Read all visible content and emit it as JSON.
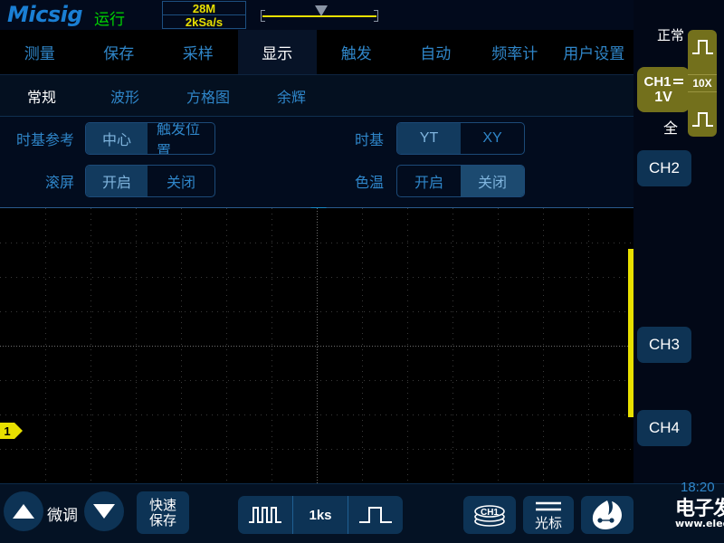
{
  "header": {
    "brand": "Micsig",
    "run_state": "运行",
    "memory_depth": "28M",
    "sample_rate": "2kSa/s",
    "trigger_marker_icon": "trigger-position-marker"
  },
  "menu": {
    "tabs": [
      {
        "label": "测量",
        "active": false
      },
      {
        "label": "保存",
        "active": false
      },
      {
        "label": "采样",
        "active": false
      },
      {
        "label": "显示",
        "active": true
      },
      {
        "label": "触发",
        "active": false
      },
      {
        "label": "自动",
        "active": false
      },
      {
        "label": "频率计",
        "active": false
      },
      {
        "label": "用户设置",
        "active": false
      }
    ]
  },
  "subtabs": [
    {
      "label": "常规",
      "active": true
    },
    {
      "label": "波形",
      "active": false
    },
    {
      "label": "方格图",
      "active": false
    },
    {
      "label": "余辉",
      "active": false
    }
  ],
  "settings": {
    "timebase_ref": {
      "label": "时基参考",
      "options": [
        {
          "label": "中心",
          "selected": true
        },
        {
          "label": "触发位置",
          "selected": false
        }
      ]
    },
    "roll": {
      "label": "滚屏",
      "options": [
        {
          "label": "开启",
          "selected": true
        },
        {
          "label": "关闭",
          "selected": false
        }
      ]
    },
    "timebase": {
      "label": "时基",
      "options": [
        {
          "label": "YT",
          "selected": true
        },
        {
          "label": "XY",
          "selected": false
        }
      ]
    },
    "color_temp": {
      "label": "色温",
      "options": [
        {
          "label": "开启",
          "selected": false
        },
        {
          "label": "关闭",
          "selected": true
        }
      ]
    }
  },
  "waveform": {
    "channel_marker": "1",
    "trigger_arrow_icon": "trigger-arrow-icon",
    "ground_bar_icon": "channel-ground-bar"
  },
  "sidebar": {
    "trigger_mode": "正常",
    "channel1": {
      "name": "CH1",
      "scale": "1V",
      "coupling_icon": "dc-coupling-icon",
      "bandwidth": "全",
      "probe_ratio": "10X",
      "probe_icon_top": "pulse-icon",
      "probe_icon_bottom": "pulse-icon"
    },
    "channels": [
      {
        "label": "CH2"
      },
      {
        "label": "CH3"
      },
      {
        "label": "CH4"
      }
    ]
  },
  "bottom": {
    "up_icon": "triangle-up-icon",
    "down_icon": "triangle-down-icon",
    "fine_label": "微调",
    "quick_save": "快速\n保存",
    "quick_save_line1": "快速",
    "quick_save_line2": "保存",
    "timebase_zoom_out_icon": "pulses-compressed-icon",
    "record_length": "1ks",
    "timebase_zoom_in_icon": "pulse-expanded-icon",
    "channel_stack_icon": "ch1-stack-icon",
    "channel_stack_label": "CH1",
    "cursor_icon": "cursor-lines-icon",
    "cursor_label": "光标",
    "app_logo_icon": "elecfans-logo-icon",
    "clock": "18:20"
  },
  "watermark": {
    "title": "电子发烧友",
    "url": "www.elecfans.com"
  },
  "colors": {
    "accent_blue": "#2f86c9",
    "channel1_yellow": "#e8e000",
    "channel1_panel": "#73701c",
    "run_green": "#00d400",
    "button_blue": "#0d3355",
    "background": "#020817"
  }
}
